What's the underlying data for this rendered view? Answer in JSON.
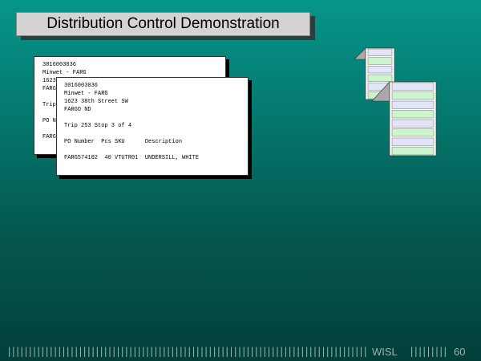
{
  "slide": {
    "title": "Distribution Control Demonstration",
    "footer_org": "WISL",
    "page_number": "60"
  },
  "label_back": {
    "lines": [
      "3016003036",
      "Minwet - FARG",
      "1623",
      "FARG",
      "",
      "Trip",
      "",
      "PO N",
      "",
      "FARG"
    ]
  },
  "label_front": {
    "lines": [
      "3016003036",
      "Minwet - FARG",
      "1623 38th Street SW",
      "FARGO ND",
      "",
      "Trip 253 Stop 3 of 4",
      "",
      "PO Number  Pcs SKU      Description",
      "",
      "FARG574102  40 VTUTR01  UNDERSILL, WHITE"
    ]
  },
  "colors": {
    "form_stripe_green": "#cdf5cd",
    "form_stripe_lavender": "#e2e4f8",
    "binding": "#a9a9a9"
  },
  "icons": [
    "continuous-form-stack-icon"
  ]
}
